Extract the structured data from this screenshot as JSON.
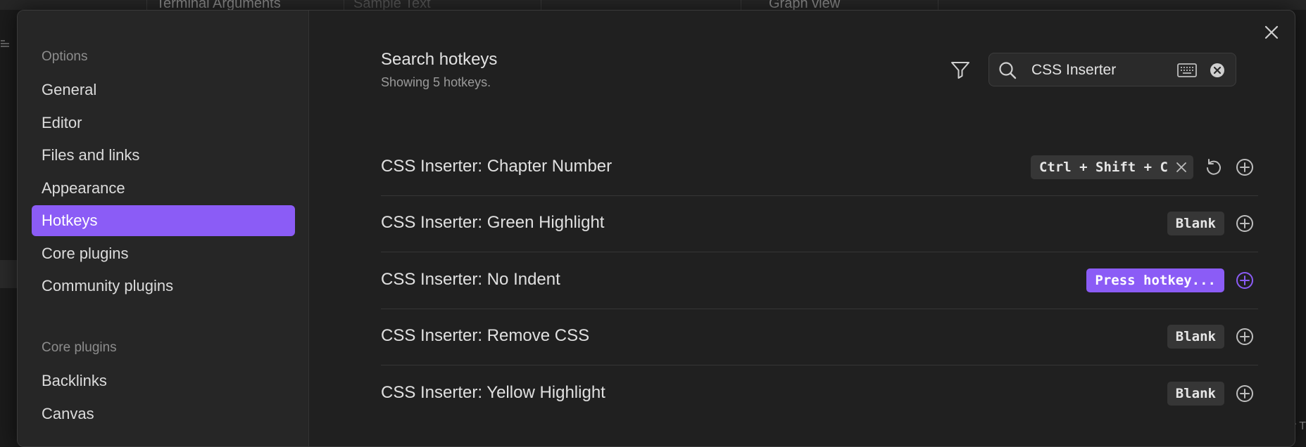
{
  "background": {
    "tabs": [
      "Terminal Arguments",
      "Sample Text",
      "Graph view"
    ],
    "corner_text": "r T"
  },
  "sidebar": {
    "options_heading": "Options",
    "options": [
      {
        "label": "General"
      },
      {
        "label": "Editor"
      },
      {
        "label": "Files and links"
      },
      {
        "label": "Appearance"
      },
      {
        "label": "Hotkeys",
        "active": true
      },
      {
        "label": "Core plugins"
      },
      {
        "label": "Community plugins"
      }
    ],
    "core_plugins_heading": "Core plugins",
    "core_plugins": [
      {
        "label": "Backlinks"
      },
      {
        "label": "Canvas"
      }
    ]
  },
  "search": {
    "title": "Search hotkeys",
    "subtitle": "Showing 5 hotkeys.",
    "value": "CSS Inserter"
  },
  "hotkeys": [
    {
      "label": "CSS Inserter: Chapter Number",
      "key": "Ctrl + Shift + C"
    },
    {
      "label": "CSS Inserter: Green Highlight",
      "key": "Blank"
    },
    {
      "label": "CSS Inserter: No Indent",
      "key": "Press hotkey..."
    },
    {
      "label": "CSS Inserter: Remove CSS",
      "key": "Blank"
    },
    {
      "label": "CSS Inserter: Yellow Highlight",
      "key": "Blank"
    }
  ],
  "colors": {
    "accent": "#8b5cf6",
    "modal_bg": "#202020",
    "sidebar_bg": "#262626",
    "kbd_bg": "#363636"
  },
  "icons": [
    "close-icon",
    "filter-icon",
    "search-icon",
    "keyboard-icon",
    "clear-search-icon",
    "remove-hotkey-icon",
    "restore-default-icon",
    "add-hotkey-icon"
  ]
}
